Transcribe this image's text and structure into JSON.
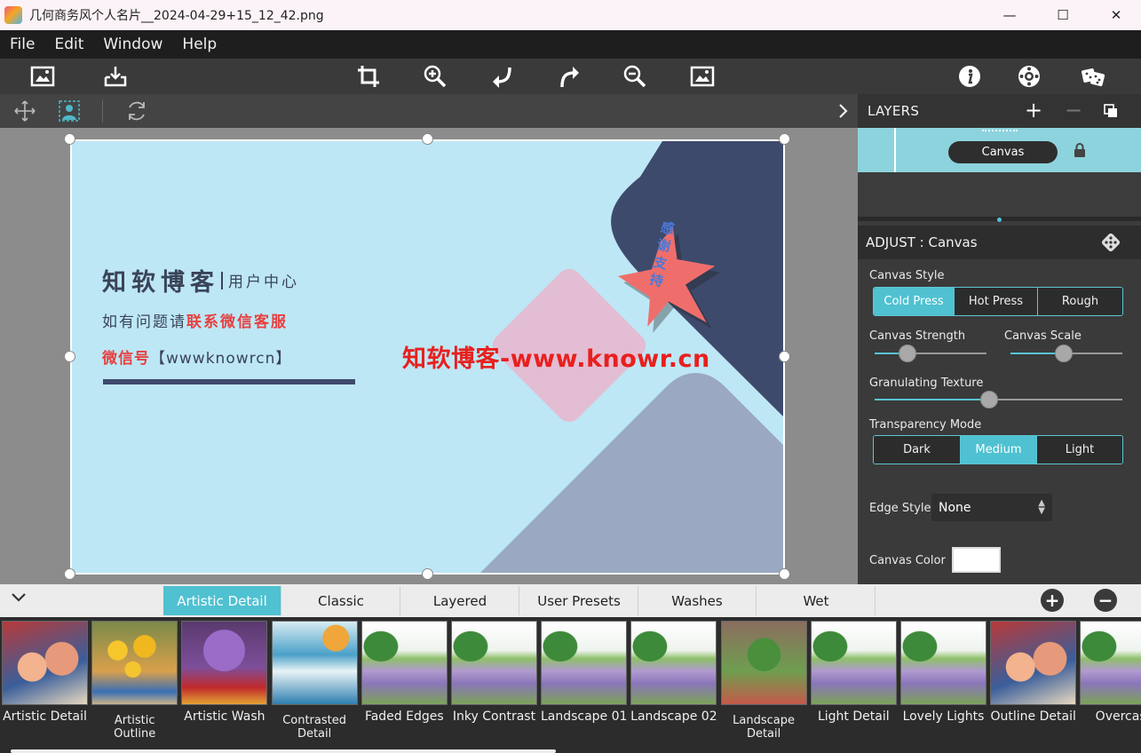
{
  "window": {
    "title": "几何商务风个人名片__2024-04-29+15_12_42.png",
    "minimize": "—",
    "maximize": "☐",
    "close": "✕"
  },
  "menu": [
    "File",
    "Edit",
    "Window",
    "Help"
  ],
  "toolbar": {
    "icons": [
      "open-image-icon",
      "save-image-icon",
      "crop-icon",
      "zoom-in-icon",
      "undo-icon",
      "redo-icon",
      "zoom-out-icon",
      "fit-image-icon",
      "info-icon",
      "settings-icon",
      "random-dice-icon"
    ]
  },
  "artboard": {
    "name": "知软博客",
    "subtitle": "用户中心",
    "line2_prefix": "如有问题请",
    "line2_highlight": "联系微信客服",
    "wechat_label": "微信号",
    "wechat_id": "【wwwknowrcn】",
    "watermark": "知软博客-www.knowr.cn",
    "star_text": "感谢支持",
    "colors": {
      "background": "#bde7f5",
      "navy": "#3e4a6c",
      "pink": "#e3bdd4",
      "grey_blue": "#9aa8c2",
      "star": "#ef6e6b",
      "red": "#e84040",
      "dark_text": "#3a4458"
    }
  },
  "layers": {
    "title": "LAYERS",
    "add": "+",
    "remove": "−",
    "layer_name": "Canvas"
  },
  "adjust": {
    "title": "ADJUST : Canvas",
    "canvas_style_label": "Canvas Style",
    "canvas_style_options": [
      "Cold Press",
      "Hot Press",
      "Rough"
    ],
    "canvas_style_selected": "Cold Press",
    "canvas_strength_label": "Canvas Strength",
    "canvas_strength": 0.25,
    "canvas_scale_label": "Canvas Scale",
    "canvas_scale": 0.47,
    "granulating_label": "Granulating Texture",
    "granulating": 0.46,
    "transparency_label": "Transparency Mode",
    "transparency_options": [
      "Dark",
      "Medium",
      "Light"
    ],
    "transparency_selected": "Medium",
    "edge_style_label": "Edge Style",
    "edge_style_value": "None",
    "canvas_color_label": "Canvas Color",
    "canvas_color": "#ffffff"
  },
  "presets": {
    "tabs": [
      "Artistic Detail",
      "Classic",
      "Layered",
      "User Presets",
      "Washes",
      "Wet"
    ],
    "active_tab": "Artistic Detail",
    "add": "+",
    "remove": "−",
    "items": [
      {
        "label": "Artistic Detail",
        "style": "portrait"
      },
      {
        "label": "Artistic Outline",
        "style": "sunflower"
      },
      {
        "label": "Artistic Wash",
        "style": "lilac"
      },
      {
        "label": "Contrasted Detail",
        "style": "boats"
      },
      {
        "label": "Faded Edges",
        "style": "landscape"
      },
      {
        "label": "Inky Contrast",
        "style": "landscape"
      },
      {
        "label": "Landscape 01",
        "style": "landscape"
      },
      {
        "label": "Landscape 02",
        "style": "landscape"
      },
      {
        "label": "Landscape Detail",
        "style": "garden"
      },
      {
        "label": "Light Detail",
        "style": "landscape"
      },
      {
        "label": "Lovely Lights",
        "style": "landscape"
      },
      {
        "label": "Outline Detail",
        "style": "portrait"
      },
      {
        "label": "Overcast",
        "style": "landscape"
      }
    ]
  }
}
